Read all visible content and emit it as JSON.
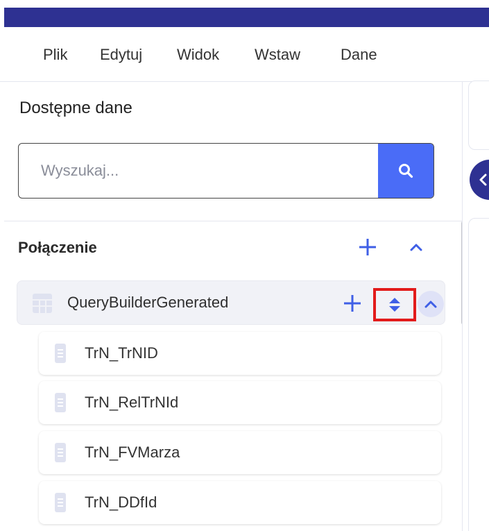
{
  "menu": {
    "items": [
      "Plik",
      "Edytuj",
      "Widok",
      "Wstaw",
      "Dane"
    ]
  },
  "panel": {
    "title": "Dostępne dane",
    "search": {
      "placeholder": "Wyszukaj...",
      "value": "",
      "button_icon": "search-icon"
    },
    "section": {
      "title": "Połączenie",
      "actions": [
        "plus-icon",
        "chevron-up-icon"
      ]
    },
    "group": {
      "label": "QueryBuilderGenerated",
      "icon": "table-icon",
      "actions": [
        "plus-icon",
        "sort-icon",
        "chevron-up-icon"
      ]
    },
    "fields": [
      {
        "label": "TrN_TrNID",
        "icon": "field-icon"
      },
      {
        "label": "TrN_RelTrNId",
        "icon": "field-icon"
      },
      {
        "label": "TrN_FVMarza",
        "icon": "field-icon"
      },
      {
        "label": "TrN_DDfId",
        "icon": "field-icon"
      }
    ]
  },
  "colors": {
    "header_band": "#2e3192",
    "search_button": "#4a6cf7",
    "accent_icon": "#3f5fe6",
    "highlight": "#e21b1b",
    "group_background": "#f1f2f7"
  }
}
